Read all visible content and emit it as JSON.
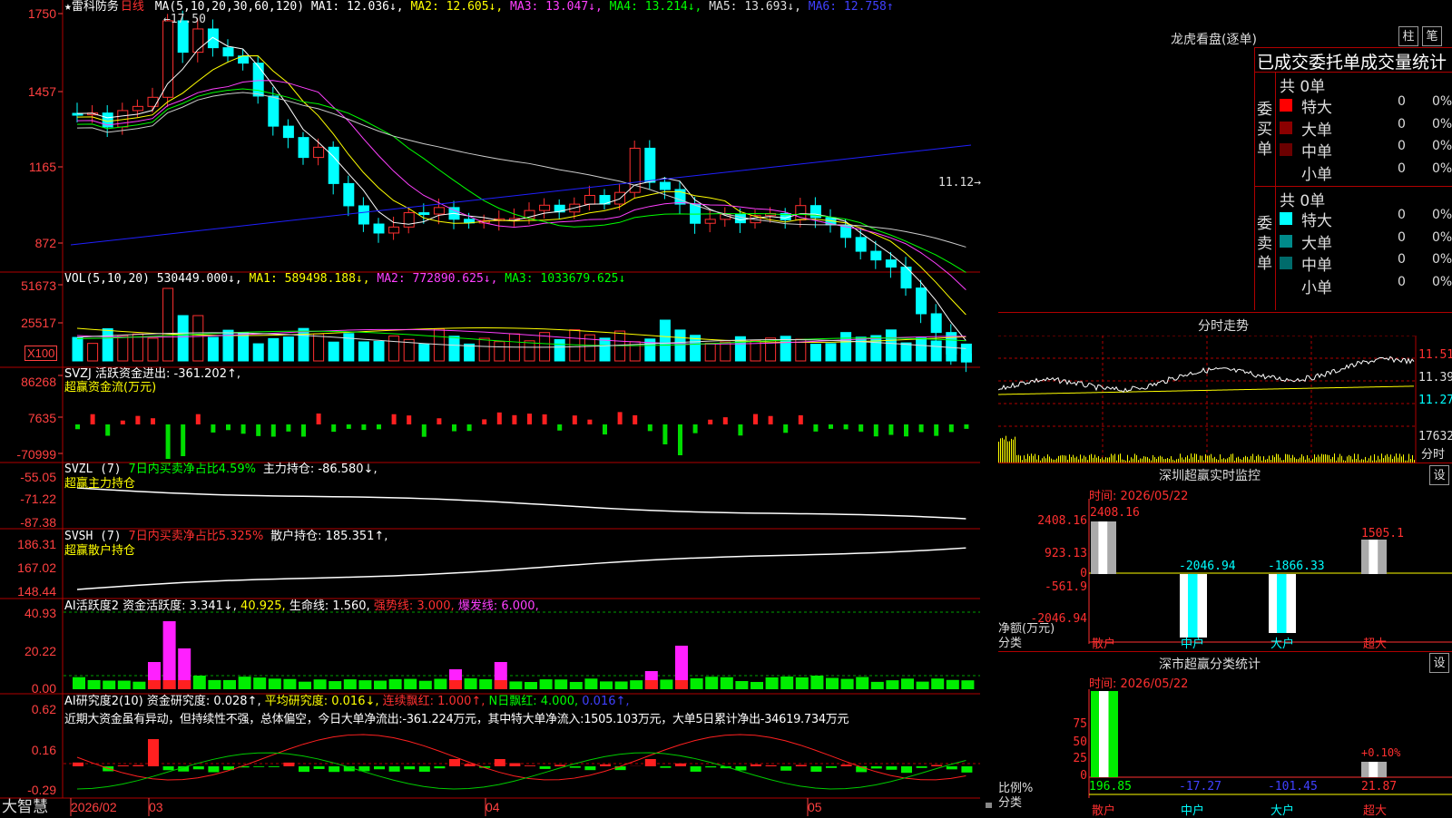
{
  "app": {
    "brand": "大智慧"
  },
  "stock": {
    "star": "★",
    "name": "雷科防务",
    "period": "日线"
  },
  "ma_line": {
    "label": "MA(5,10,20,30,60,120)",
    "ma1": "MA1: 12.036↓,",
    "ma2": "MA2: 12.605↓,",
    "ma3": "MA3: 13.047↓,",
    "ma4": "MA4: 13.214↓,",
    "ma5": "MA5: 13.693↓,",
    "ma6": "MA6: 12.758↑"
  },
  "main_axis": [
    "1750",
    "1457",
    "1165",
    "872"
  ],
  "annotations": {
    "high": "←17.50",
    "low": "11.12→"
  },
  "vol": {
    "label": "VOL(5,10,20)",
    "val": "530449.000↓,",
    "ma1": "MA1: 589498.188↓,",
    "ma2": "MA2: 772890.625↓,",
    "ma3": "MA3: 1033679.625↓",
    "axis": [
      "51673",
      "25517"
    ],
    "unit": "X100"
  },
  "svzj": {
    "label": "SVZJ  活跃资金进出: -361.202↑,",
    "sub": "超赢资金流(万元)",
    "axis": [
      "86268",
      "7635",
      "-70999"
    ]
  },
  "svzl": {
    "label_a": "SVZL (7)",
    "label_b": "7日内买卖净占比4.59%",
    "label_c": "主力持仓: -86.580↓,",
    "sub": "超赢主力持仓",
    "axis": [
      "-55.05",
      "-71.22",
      "-87.38"
    ]
  },
  "svsh": {
    "label_a": "SVSH (7)",
    "label_b": "7日内买卖净占比5.325%",
    "label_c": "散户持仓: 185.351↑,",
    "sub": "超赢散户持仓",
    "axis": [
      "186.31",
      "167.02",
      "148.44"
    ]
  },
  "ai_active": {
    "a": "AI活跃度2",
    "b": "资金活跃度: 3.341↓,",
    "c": "40.925,",
    "d": "生命线: 1.560,",
    "e": "强势线: 3.000,",
    "f": "爆发线: 6.000,",
    "axis": [
      "40.93",
      "20.22",
      "0.00"
    ]
  },
  "ai_research": {
    "a": "AI研究度2(10)",
    "b": "资金研究度: 0.028↑,",
    "c": "平均研究度: 0.016↓,",
    "d": "连续飘红: 1.000↑,",
    "e": "N日飘红: 4.000,",
    "f": "0.016↑,",
    "note": "近期大资金虽有异动，但持续性不强，总体偏空，今日大单净流出:-361.224万元，其中特大单净流入:1505.103万元，大单5日累计净出-34619.734万元",
    "axis": [
      "0.62",
      "0.16",
      "-0.29"
    ]
  },
  "xaxis": [
    "2026/02",
    "03",
    "04",
    "05"
  ],
  "right": {
    "lhb_title": "龙虎看盘(逐单)",
    "btn1": "柱",
    "btn2": "笔",
    "order_title": "已成交委托单成交量统计",
    "buy_label": "委买单",
    "sell_label": "委卖单",
    "buy_total": "共 0单",
    "sell_total": "共 0单",
    "rows": [
      {
        "name": "特大",
        "v": "0",
        "p": "0%"
      },
      {
        "name": "大单",
        "v": "0",
        "p": "0%"
      },
      {
        "name": "中单",
        "v": "0",
        "p": "0%"
      },
      {
        "name": "小单",
        "v": "0",
        "p": "0%"
      }
    ],
    "colors": {
      "buy": [
        "#ff0000",
        "#8b0000",
        "#6b0000"
      ],
      "sell": [
        "#00ffff",
        "#008b8b",
        "#006b6b"
      ]
    },
    "intraday_title": "分时走势",
    "intraday_axis": [
      "11.51",
      "11.39",
      "11.27",
      "17632"
    ],
    "intraday_unit": "分时",
    "monitor_title": "深圳超赢实时监控",
    "monitor_btn": "设",
    "monitor_time": "时间: 2026/05/22",
    "monitor_axis": [
      "2408.16",
      "923.13",
      "0",
      "-561.9",
      "-2046.94"
    ],
    "monitor_vals": [
      "2408.16",
      "-2046.94",
      "-1866.33",
      "1505.1"
    ],
    "monitor_ylabel_a": "净额(万元)",
    "monitor_ylabel_b": "分类",
    "cats": [
      "散户",
      "中户",
      "大户",
      "超大"
    ],
    "stats_title": "深市超赢分类统计",
    "stats_btn": "设",
    "stats_time": "时间: 2026/05/22",
    "stats_axis": [
      "75",
      "50",
      "25",
      "0"
    ],
    "stats_vals": [
      "196.85",
      "-17.27",
      "-101.45",
      "21.87"
    ],
    "stats_pct": "+0.10%",
    "stats_ylabel_a": "比例%",
    "stats_ylabel_b": "分类"
  }
}
